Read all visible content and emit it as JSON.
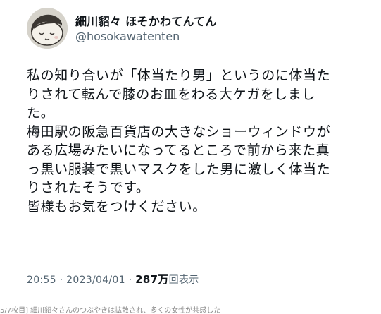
{
  "user": {
    "display_name": "細川貂々 ほそかわてんてん",
    "handle": "@hosokawatenten",
    "avatar_icon": "cartoon-face-avatar"
  },
  "tweet": {
    "lines": [
      "私の知り合いが「体当たり男」というのに体当た",
      "りされて転んで膝のお皿をわる大ケガをしまし",
      "た。",
      "梅田駅の阪急百貨店の大きなショーウィンドウが",
      "ある広場みたいになってるところで前から来た真",
      "っ黒い服装で黒いマスクをした男に激しく体当た",
      "りされたそうです。",
      "皆様もお気をつけください。"
    ]
  },
  "meta": {
    "time": "20:55",
    "separator": "·",
    "date": "2023/04/01",
    "views_count": "287万",
    "views_label": "回表示"
  },
  "caption": {
    "text": "5/7枚目] 細川貂々さんのつぶやきは拡散され、多くの女性が共感した"
  },
  "colors": {
    "text_primary": "#0f1419",
    "text_secondary": "#536471",
    "background": "#ffffff"
  }
}
